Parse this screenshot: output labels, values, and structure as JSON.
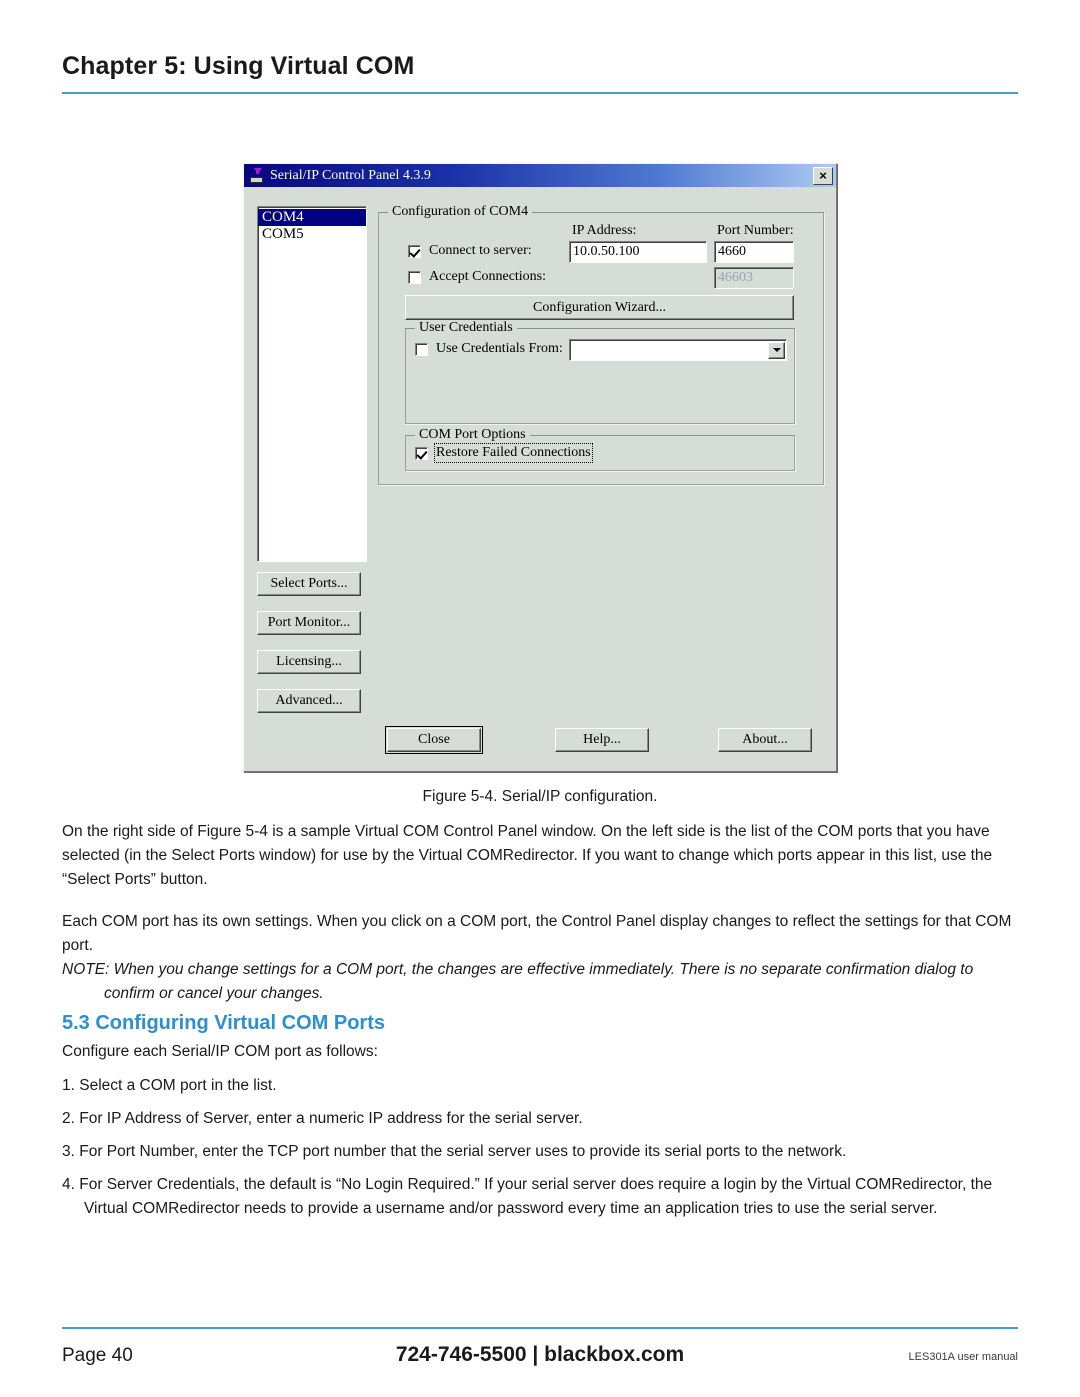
{
  "page": {
    "chapter_title": "Chapter 5: Using Virtual COM",
    "accent_color": "#3d9fd4",
    "heading_color": "#2b8fd0"
  },
  "dialog": {
    "titlebar": {
      "title": "Serial/IP Control Panel 4.3.9",
      "icon": "serial-device-download-icon",
      "close_label": "×",
      "gradient_from": "#07077f",
      "gradient_to": "#adcbf2"
    },
    "port_list": {
      "items": [
        {
          "label": "COM4",
          "selected": true
        },
        {
          "label": "COM5",
          "selected": false
        }
      ],
      "selection_color": "#000080"
    },
    "side_buttons": [
      {
        "label": "Select Ports..."
      },
      {
        "label": "Port Monitor..."
      },
      {
        "label": "Licensing..."
      },
      {
        "label": "Advanced..."
      }
    ],
    "configuration_group": {
      "legend": "Configuration of COM4",
      "ip_address_label": "IP Address:",
      "port_number_label": "Port Number:",
      "connect_to_server": {
        "label": "Connect to server:",
        "checked": true,
        "ip_value": "10.0.50.100",
        "port_value": "4660"
      },
      "accept_connections": {
        "label": "Accept Connections:",
        "checked": false,
        "port_value": "46603",
        "disabled": true
      },
      "wizard_button": "Configuration Wizard..."
    },
    "user_credentials_group": {
      "legend": "User Credentials",
      "use_credentials_from": {
        "label": "Use Credentials From:",
        "checked": false,
        "value": ""
      }
    },
    "com_port_options_group": {
      "legend": "COM Port Options",
      "restore_failed_connections": {
        "label": "Restore Failed Connections",
        "checked": true,
        "focused": true
      }
    },
    "bottom_buttons": [
      {
        "label": "Close",
        "default": true
      },
      {
        "label": "Help...",
        "default": false
      },
      {
        "label": "About...",
        "default": false
      }
    ]
  },
  "content": {
    "figure_caption": "Figure 5-4. Serial/IP configuration.",
    "paragraph_1": "On the right side of Figure 5-4 is a sample Virtual COM Control Panel window. On the left side is the list of the COM ports that you have selected (in the Select Ports window) for use by the Virtual COMRedirector. If you want to change which ports appear in this list, use the “Select Ports” button.",
    "paragraph_2": "Each COM port has its own settings. When you click on a COM port, the Control Panel display changes to reflect the settings for that COM port.",
    "note": "NOTE: When you change settings for a COM port, the changes are effective immediately. There is no separate confirmation dialog to confirm or cancel your changes.",
    "section_heading": "5.3 Configuring Virtual COM Ports",
    "intro": "Configure each Serial/IP COM port as follows:",
    "steps": [
      "1. Select a COM port in the list.",
      "2. For IP Address of Server, enter a numeric IP address for the serial server.",
      "3. For Port Number, enter the TCP port number that the serial server uses to provide its serial ports to the network.",
      "4. For Server Credentials, the default is “No Login Required.” If your serial server does require a login by the Virtual COMRedirector, the Virtual COMRedirector needs to provide a username and/or password every time an application tries to use the serial server."
    ]
  },
  "footer": {
    "page_number": "Page 40",
    "contact": "724-746-5500  |  blackbox.com",
    "manual": "LES301A user manual"
  }
}
